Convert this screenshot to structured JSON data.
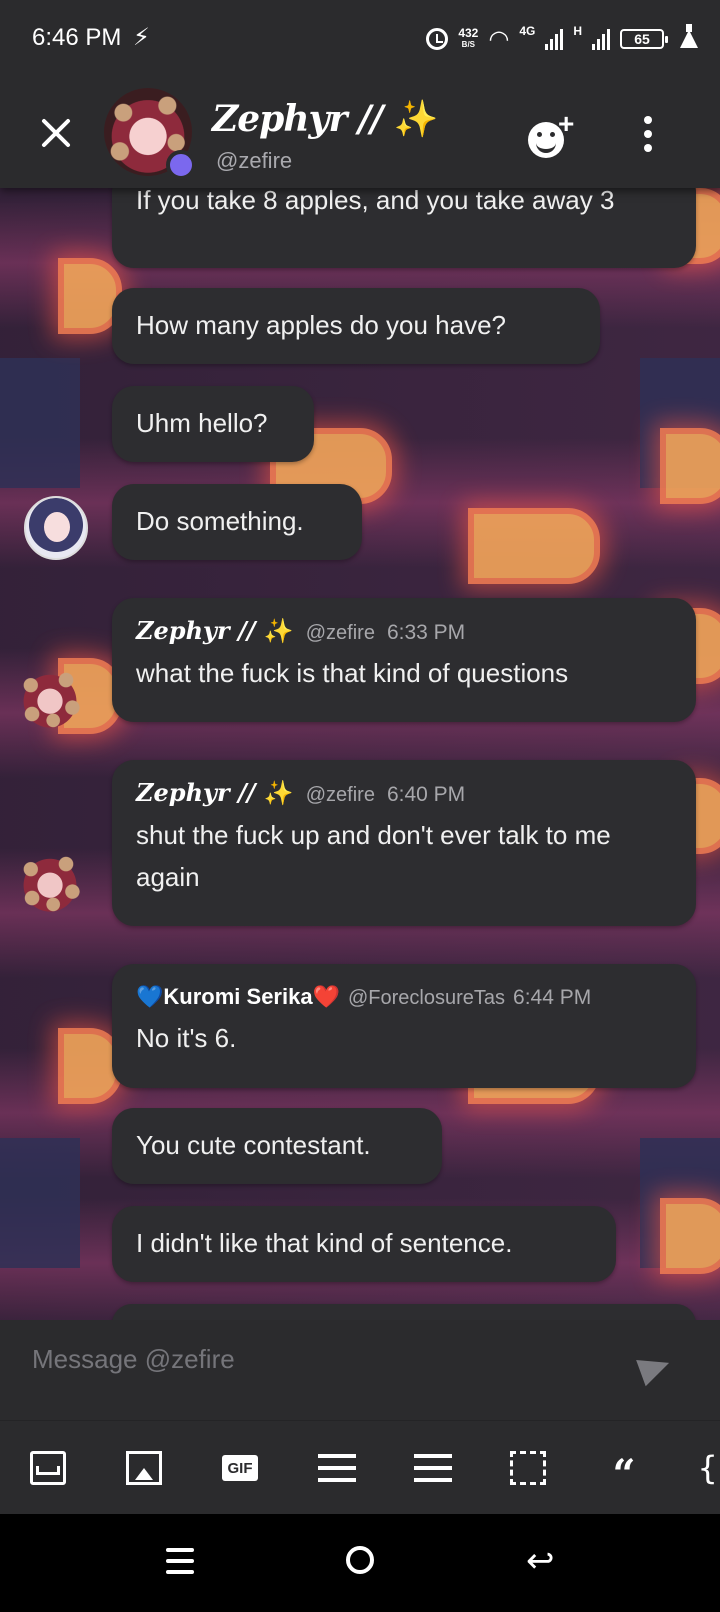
{
  "status_bar": {
    "time": "6:46 PM",
    "speed_value": "432",
    "speed_unit": "B/S",
    "network": "4G",
    "network2": "H",
    "battery": "65"
  },
  "header": {
    "name": "Zephyr //",
    "sparkle": "✨",
    "handle": "@zefire"
  },
  "messages": [
    {
      "text": "If you take 8 apples, and you take away 3"
    },
    {
      "text": "How many apples do you have?"
    },
    {
      "text": "Uhm hello?"
    },
    {
      "text": "Do something."
    },
    {
      "author": "Zephyr //",
      "author_emoji": "✨",
      "handle": "@zefire",
      "time": "6:33 PM",
      "text": "what the fuck is that kind of questions"
    },
    {
      "author": "Zephyr //",
      "author_emoji": "✨",
      "handle": "@zefire",
      "time": "6:40 PM",
      "text": "shut the fuck up and don't ever talk to me again"
    },
    {
      "author_prefix": "💙",
      "author": "Kuromi Serika",
      "author_suffix": "❤️",
      "handle": "@ForeclosureTas",
      "time": "6:44 PM",
      "text": "No it's 6."
    },
    {
      "text": "You cute contestant."
    },
    {
      "text": "I didn't like that kind of sentence."
    }
  ],
  "composer": {
    "placeholder": "Message @zefire"
  },
  "toolbar": {
    "gif_label": "GIF",
    "quote_glyph": "“",
    "brace_glyph": "{"
  },
  "colors": {
    "bubble": "#2d2d30",
    "header": "#2b2b2d",
    "online": "#7b68ee",
    "accent_glow": "#f07a52"
  }
}
